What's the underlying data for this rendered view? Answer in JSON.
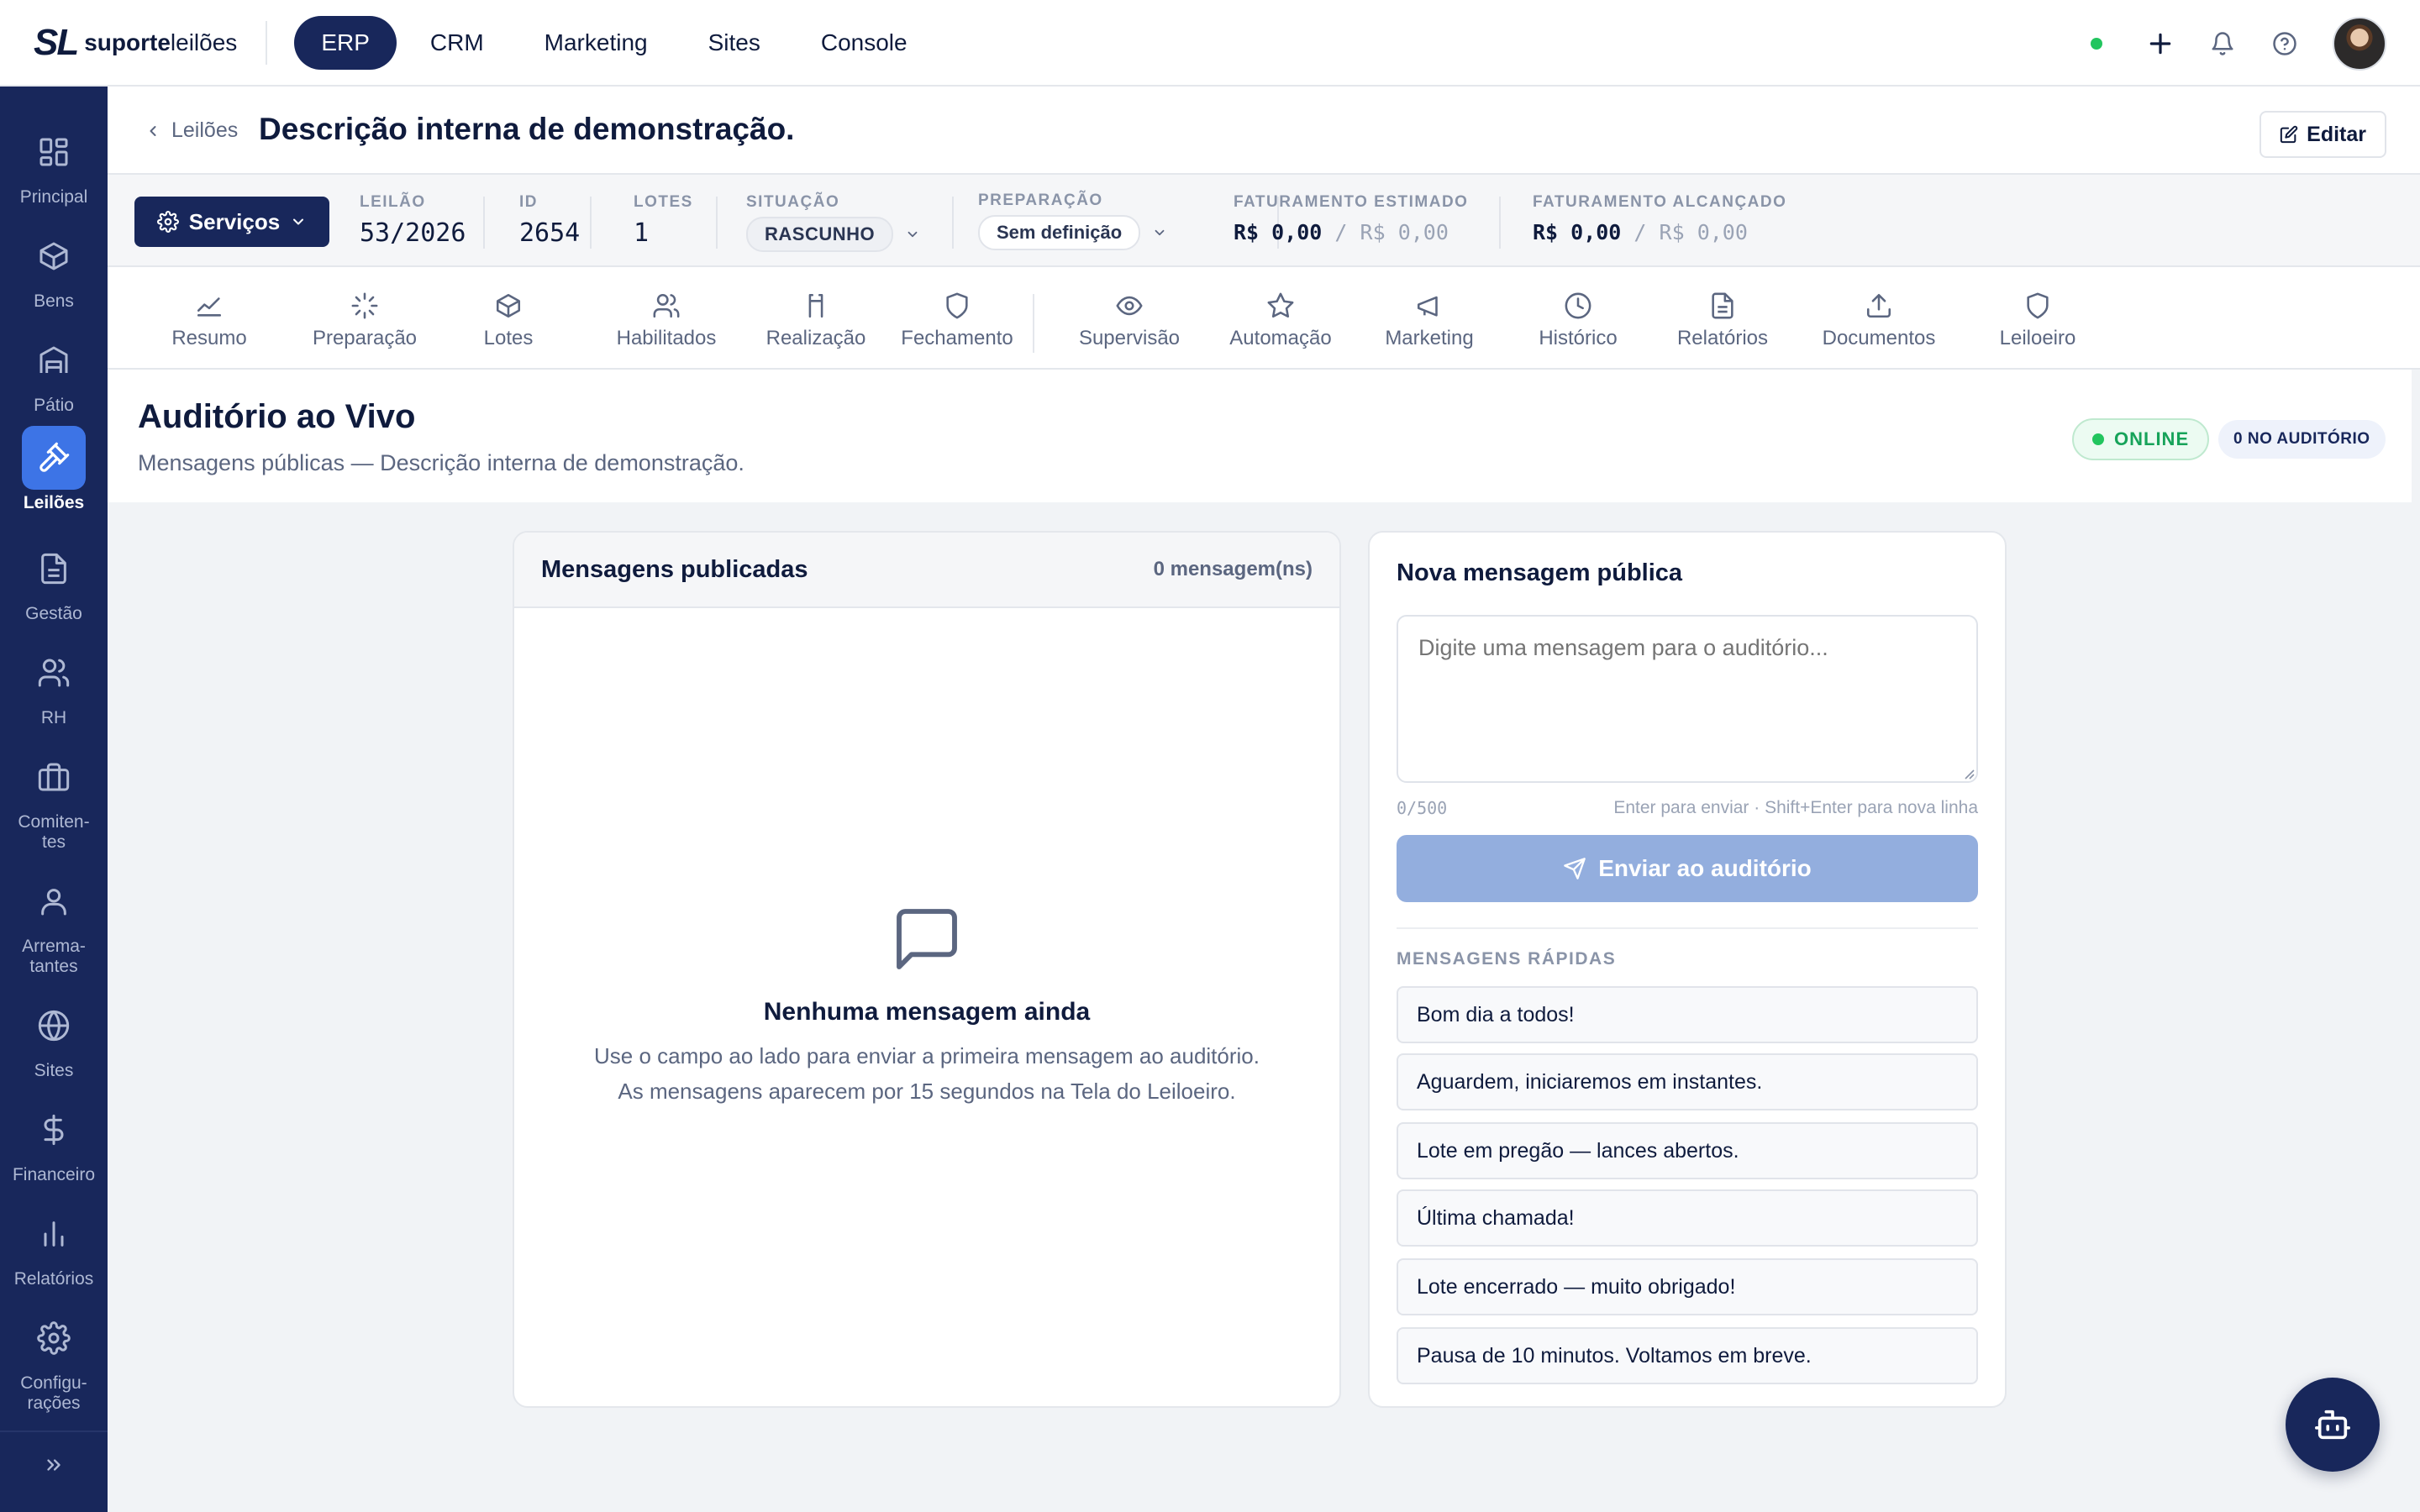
{
  "brand": {
    "mark": "SL",
    "name_bold": "suporte",
    "name_light": "leilões"
  },
  "topnav": [
    {
      "label": "ERP",
      "active": true
    },
    {
      "label": "CRM"
    },
    {
      "label": "Marketing"
    },
    {
      "label": "Sites"
    },
    {
      "label": "Console"
    }
  ],
  "sidebar": [
    {
      "label": "Principal",
      "icon": "grid-icon"
    },
    {
      "label": "Bens",
      "icon": "box-icon"
    },
    {
      "label": "Pátio",
      "icon": "warehouse-icon"
    },
    {
      "label": "Leilões",
      "icon": "gavel-icon",
      "active": true
    },
    {
      "label": "Gestão",
      "icon": "document-icon"
    },
    {
      "label": "RH",
      "icon": "users-icon"
    },
    {
      "label": "Comiten-\ntes",
      "icon": "briefcase-icon"
    },
    {
      "label": "Arrema-\ntantes",
      "icon": "user-icon"
    },
    {
      "label": "Sites",
      "icon": "globe-icon"
    },
    {
      "label": "Financeiro",
      "icon": "dollar-icon"
    },
    {
      "label": "Relatórios",
      "icon": "bar-chart-icon"
    },
    {
      "label": "Configu-\nrações",
      "icon": "gear-icon"
    }
  ],
  "header": {
    "breadcrumb": "Leilões",
    "title": "Descrição interna de demonstração.",
    "edit_label": "Editar"
  },
  "info": {
    "services_label": "Serviços",
    "leilao": {
      "label": "LEILÃO",
      "value": "53/2026"
    },
    "id": {
      "label": "ID",
      "value": "2654"
    },
    "lotes": {
      "label": "LOTES",
      "value": "1"
    },
    "situacao": {
      "label": "SITUAÇÃO",
      "value": "RASCUNHO"
    },
    "preparacao": {
      "label": "PREPARAÇÃO",
      "value": "Sem definição"
    },
    "fat_estimado": {
      "label": "FATURAMENTO ESTIMADO",
      "value": "R$ 0,00",
      "sep": "/",
      "secondary": "R$ 0,00"
    },
    "fat_alcancado": {
      "label": "FATURAMENTO ALCANÇADO",
      "value": "R$ 0,00",
      "sep": "/",
      "secondary": "R$ 0,00"
    }
  },
  "tabs": [
    {
      "label": "Resumo",
      "icon": "trend-icon"
    },
    {
      "label": "Preparação",
      "icon": "loader-icon"
    },
    {
      "label": "Lotes",
      "icon": "box-icon"
    },
    {
      "label": "Habilitados",
      "icon": "users-icon"
    },
    {
      "label": "Realização",
      "icon": "bracket-icon"
    },
    {
      "label": "Fechamento",
      "icon": "shield-icon"
    },
    {
      "label": "Supervisão",
      "icon": "eye-icon"
    },
    {
      "label": "Automação",
      "icon": "star-icon"
    },
    {
      "label": "Marketing",
      "icon": "megaphone-icon"
    },
    {
      "label": "Histórico",
      "icon": "clock-icon"
    },
    {
      "label": "Relatórios",
      "icon": "file-icon"
    },
    {
      "label": "Documentos",
      "icon": "upload-icon"
    },
    {
      "label": "Leiloeiro",
      "icon": "shield-icon"
    }
  ],
  "section": {
    "title": "Auditório ao Vivo",
    "subtitle": "Mensagens públicas — Descrição interna de demonstração.",
    "online_label": "ONLINE",
    "audience_label": "0 NO AUDITÓRIO"
  },
  "messages": {
    "title": "Mensagens publicadas",
    "count": "0 mensagem(ns)",
    "empty_title": "Nenhuma mensagem ainda",
    "empty_line1": "Use o campo ao lado para enviar a primeira mensagem ao auditório.",
    "empty_line2": "As mensagens aparecem por 15 segundos na Tela do Leiloeiro."
  },
  "compose": {
    "title": "Nova mensagem pública",
    "placeholder": "Digite uma mensagem para o auditório...",
    "counter": "0/500",
    "hint": "Enter para enviar · Shift+Enter para nova linha",
    "send_label": "Enviar ao auditório",
    "quick_label": "MENSAGENS RÁPIDAS",
    "quick": [
      "Bom dia a todos!",
      "Aguardem, iniciaremos em instantes.",
      "Lote em pregão — lances abertos.",
      "Última chamada!",
      "Lote encerrado — muito obrigado!",
      "Pausa de 10 minutos. Voltamos em breve."
    ]
  },
  "colors": {
    "navy": "#18275b",
    "accent": "#3d74e6",
    "online": "#22c55e",
    "send_disabled": "#93aede"
  }
}
